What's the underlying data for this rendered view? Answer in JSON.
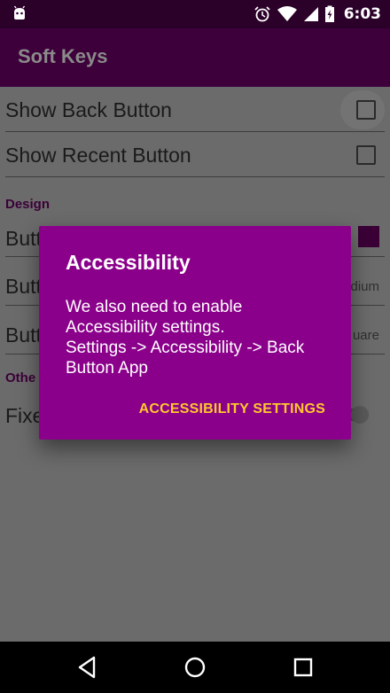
{
  "status_bar": {
    "time": "6:03",
    "icons": [
      "android-icon",
      "alarm-icon",
      "wifi-icon",
      "signal-icon",
      "battery-charging-icon"
    ]
  },
  "app_bar": {
    "title": "Soft Keys"
  },
  "settings": {
    "show_back_label": "Show Back Button",
    "show_recent_label": "Show Recent Button",
    "design_section": "Design",
    "button_color_label": "Butt",
    "button_size_label": "Butt",
    "button_size_summary": "dium",
    "button_shape_label": "Butt",
    "button_shape_summary": "uare",
    "other_section": "Othe",
    "fixed_label": "Fixe"
  },
  "dialog": {
    "title": "Accessibility",
    "message_lines": [
      "We also need to enable",
      "Accessibility settings.",
      "Settings -> Accessibility -> Back",
      "Button App"
    ],
    "positive_button": "ACCESSIBILITY SETTINGS"
  },
  "colors": {
    "app_bar": "#3e003b",
    "status_bar": "#2b0029",
    "dialog_bg": "#8b008b",
    "dialog_button": "#ffc72c",
    "scrim_bg": "#6b6b6b"
  }
}
